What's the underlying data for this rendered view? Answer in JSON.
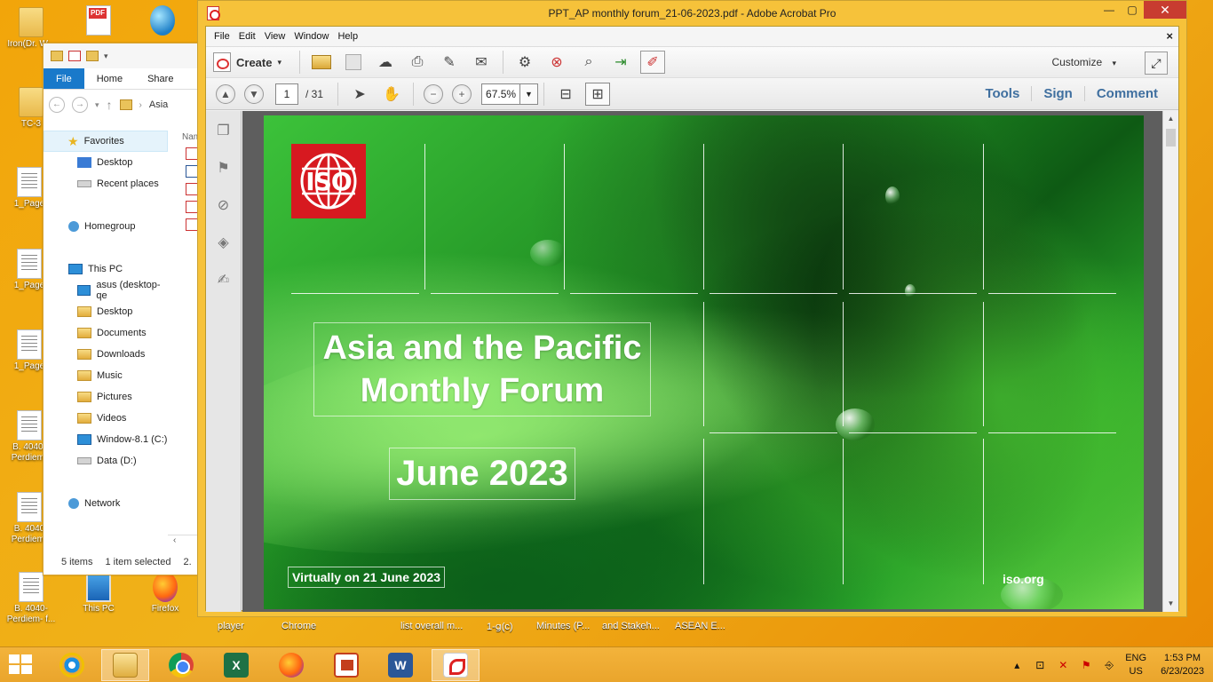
{
  "desktop": {
    "icons": [
      {
        "label": "Iron(Dr. W...",
        "type": "folder"
      },
      {
        "label": "",
        "type": "pdf"
      },
      {
        "label": "",
        "type": "globe"
      },
      {
        "label": "TC-3",
        "type": "folder"
      },
      {
        "label": "1_Page",
        "type": "doc"
      },
      {
        "label": "1_Page",
        "type": "doc"
      },
      {
        "label": "1_Page",
        "type": "doc"
      },
      {
        "label": "B. 4040-\nPerdiem-",
        "type": "doc"
      },
      {
        "label": "B. 4040\nPerdiem-",
        "type": "doc"
      },
      {
        "label": "B. 4040-\nPerdiem- f...",
        "type": "doc"
      },
      {
        "label": "This PC",
        "type": "pc"
      },
      {
        "label": "Firefox",
        "type": "ff"
      }
    ]
  },
  "explorer": {
    "ribbon_tabs": [
      "File",
      "Home",
      "Share"
    ],
    "breadcrumb": "Asia",
    "column_header": "Nam",
    "nav": {
      "favorites": "Favorites",
      "favorites_items": [
        "Desktop",
        "Recent places"
      ],
      "homegroup": "Homegroup",
      "this_pc": "This PC",
      "this_pc_items": [
        "asus (desktop-qe",
        "Desktop",
        "Documents",
        "Downloads",
        "Music",
        "Pictures",
        "Videos",
        "Window-8.1 (C:)",
        "Data (D:)"
      ],
      "network": "Network"
    },
    "status": {
      "items": "5 items",
      "selected": "1 item selected",
      "size": "2."
    }
  },
  "acrobat": {
    "title": "PPT_AP monthly forum_21-06-2023.pdf - Adobe Acrobat Pro",
    "window_buttons": {
      "minimize": "—",
      "restore": "▢",
      "close": "✕"
    },
    "menu": [
      "File",
      "Edit",
      "View",
      "Window",
      "Help"
    ],
    "doc_close": "×",
    "toolbar": {
      "create_label": "Create",
      "customize_label": "Customize"
    },
    "nav": {
      "current_page": "1",
      "page_total": "/ 31",
      "zoom": "67.5%"
    },
    "panels": [
      "Tools",
      "Sign",
      "Comment"
    ]
  },
  "slide": {
    "logo_text": "ISO",
    "title_line1": "Asia and the Pacific",
    "title_line2": "Monthly Forum",
    "date": "June 2023",
    "virtual": "Virtually on 21 June 2023",
    "site": "iso.org"
  },
  "taskbar_labels": [
    "player",
    "Chrome",
    "list overall m...",
    "1-ց(c)",
    "Minutes (P...",
    "and Stakeh...",
    "ASEAN E..."
  ],
  "tray": {
    "lang1": "ENG",
    "lang2": "US",
    "time": "1:53 PM",
    "date": "6/23/2023"
  }
}
